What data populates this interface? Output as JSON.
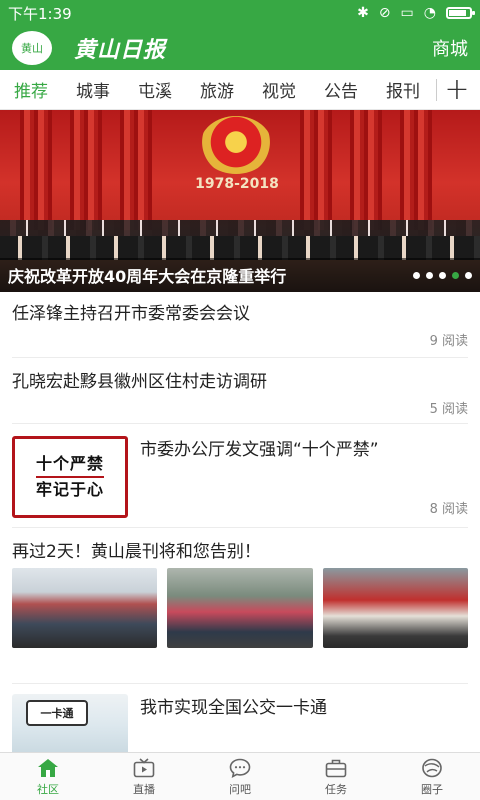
{
  "status_bar": {
    "time": "下午1:39"
  },
  "header": {
    "logo_badge": "黄山日报",
    "logo_text": "黄山日报",
    "shop_label": "商城"
  },
  "tabs": [
    {
      "label": "推荐",
      "active": true
    },
    {
      "label": "城事"
    },
    {
      "label": "屯溪"
    },
    {
      "label": "旅游"
    },
    {
      "label": "视觉"
    },
    {
      "label": "公告"
    },
    {
      "label": "报刊"
    }
  ],
  "banner": {
    "years": "1978-2018",
    "title": "庆祝改革开放40周年大会在京隆重举行",
    "dots_total": 5,
    "dots_active_index": 3
  },
  "news": [
    {
      "title": "任泽锋主持召开市委常委会会议",
      "reads": "9 阅读"
    },
    {
      "title": "孔晓宏赴黟县徽州区住村走访调研",
      "reads": "5 阅读"
    },
    {
      "title": "市委办公厅发文强调“十个严禁”",
      "reads": "8 阅读",
      "thumb_line1": "十个严禁",
      "thumb_line2": "牢记于心"
    },
    {
      "title": "再过2天！黄山晨刊将和您告别！"
    },
    {
      "title": "我市实现全国公交一卡通",
      "thumb_card": "一卡通"
    }
  ],
  "bottom_nav": [
    {
      "label": "社区",
      "icon": "home-icon",
      "active": true
    },
    {
      "label": "直播",
      "icon": "tv-icon"
    },
    {
      "label": "问吧",
      "icon": "chat-icon"
    },
    {
      "label": "任务",
      "icon": "briefcase-icon"
    },
    {
      "label": "圈子",
      "icon": "circle-icon"
    }
  ],
  "colors": {
    "brand": "#37a844",
    "active_tab": "#37a844"
  }
}
